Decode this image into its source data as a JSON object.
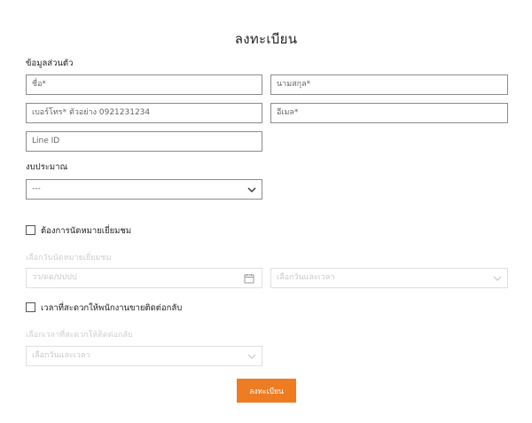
{
  "page": {
    "title": "ลงทะเบียน"
  },
  "personal": {
    "heading": "ข้อมูลส่วนตัว",
    "first_name_placeholder": "ชื่อ*",
    "last_name_placeholder": "นามสกุล*",
    "phone_placeholder": "เบอร์โทร* ตัวอย่าง 0921231234",
    "email_placeholder": "อีเมล*",
    "line_placeholder": "Line ID"
  },
  "budget": {
    "heading": "งบประมาณ",
    "selected": "---"
  },
  "appointment": {
    "checkbox_label": "ต้องการนัดหมายเยี่ยมชม",
    "checked": false,
    "hint": "เลือกวันนัดหมายเยี่ยมชม",
    "date_placeholder": "วว/ดด/ปปปป",
    "time_selected": "เลือกวันและเวลา"
  },
  "callback": {
    "checkbox_label": "เวลาที่สะดวกให้พนักงานขายติดต่อกลับ",
    "checked": false,
    "hint": "เลือกเวลาที่สะดวกให้ติดต่อกลับ",
    "time_selected": "เลือกวันและเวลา"
  },
  "submit": {
    "label": "ลงทะเบียน"
  },
  "colors": {
    "accent": "#ee7c22",
    "border": "#8c8c8c",
    "disabled": "#e0e0e0"
  }
}
